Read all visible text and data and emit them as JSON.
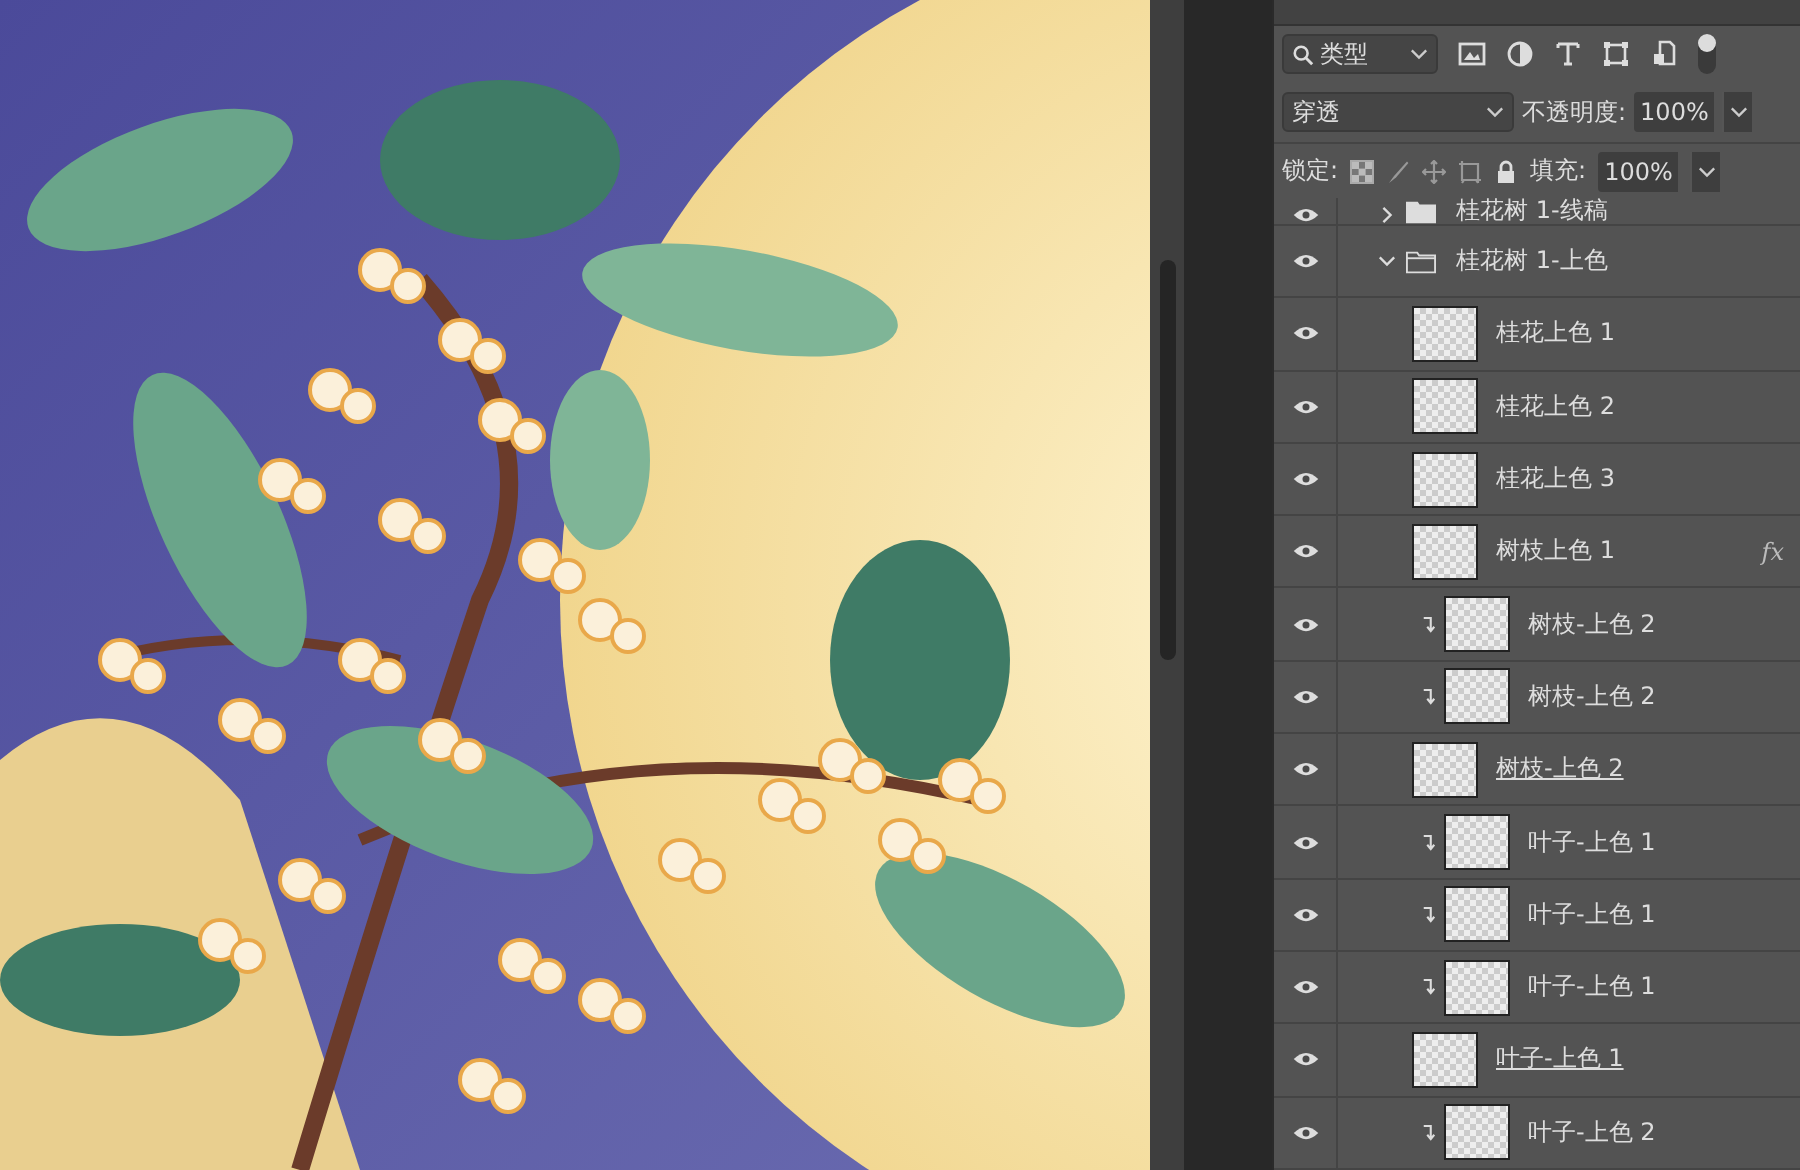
{
  "toolbar": {
    "filter": "类型",
    "blend_mode": "穿透",
    "opacity_label": "不透明度:",
    "opacity": "100%",
    "lock_label": "锁定:",
    "fill_label": "填充:",
    "fill": "100%"
  },
  "layers": [
    {
      "kind": "group",
      "name": "桂花树 1-线稿",
      "visible": true,
      "expanded": false
    },
    {
      "kind": "group",
      "name": "桂花树 1-上色",
      "visible": true,
      "expanded": true,
      "children": [
        {
          "kind": "layer",
          "name": "桂花上色 1",
          "visible": true,
          "clipped": false,
          "underlined": false
        },
        {
          "kind": "layer",
          "name": "桂花上色 2",
          "visible": true,
          "clipped": false,
          "underlined": false
        },
        {
          "kind": "layer",
          "name": "桂花上色 3",
          "visible": true,
          "clipped": false,
          "underlined": false
        },
        {
          "kind": "layer",
          "name": "树枝上色 1",
          "visible": true,
          "clipped": false,
          "underlined": false,
          "fx": "fx"
        },
        {
          "kind": "layer",
          "name": "树枝-上色 2",
          "visible": true,
          "clipped": true,
          "underlined": false
        },
        {
          "kind": "layer",
          "name": "树枝-上色 2",
          "visible": true,
          "clipped": true,
          "underlined": false
        },
        {
          "kind": "layer",
          "name": "树枝-上色 2",
          "visible": true,
          "clipped": false,
          "underlined": true
        },
        {
          "kind": "layer",
          "name": "叶子-上色 1",
          "visible": true,
          "clipped": true,
          "underlined": false
        },
        {
          "kind": "layer",
          "name": "叶子-上色 1",
          "visible": true,
          "clipped": true,
          "underlined": false
        },
        {
          "kind": "layer",
          "name": "叶子-上色 1",
          "visible": true,
          "clipped": true,
          "underlined": false
        },
        {
          "kind": "layer",
          "name": "叶子-上色 1",
          "visible": true,
          "clipped": false,
          "underlined": true
        },
        {
          "kind": "layer",
          "name": "叶子-上色 2",
          "visible": true,
          "clipped": true,
          "underlined": false
        }
      ]
    }
  ]
}
